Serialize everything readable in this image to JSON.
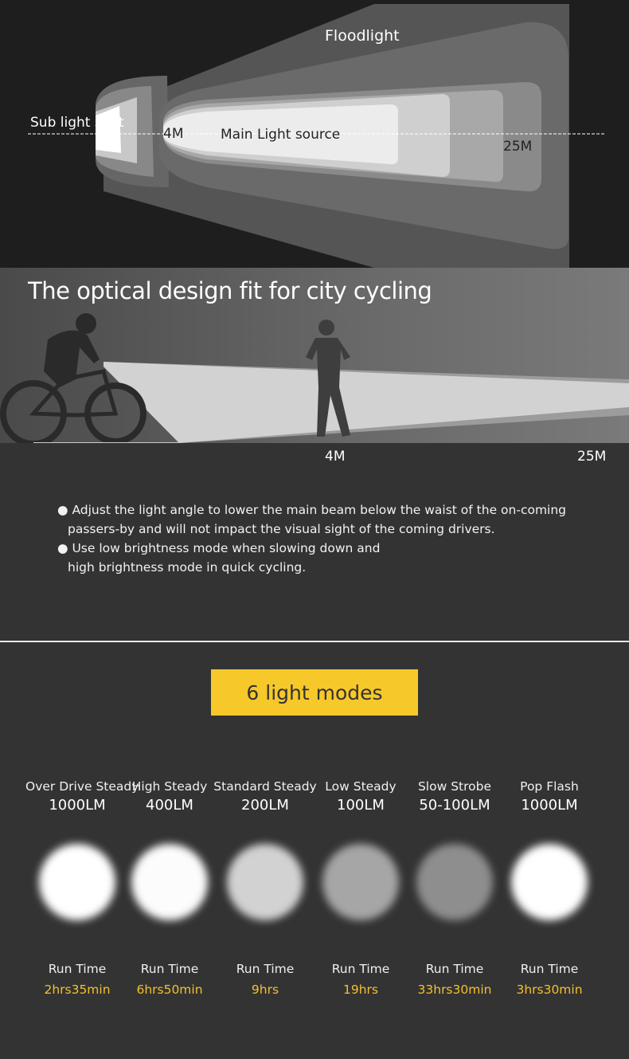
{
  "beam_diagram": {
    "floodlight": "Floodlight",
    "sub_light_spot": "Sub light spot",
    "main_light_source": "Main Light source",
    "near_distance": "4M",
    "far_distance": "25M"
  },
  "city": {
    "title": "The optical design fit for city cycling",
    "near_distance": "4M",
    "far_distance": "25M",
    "bullets": [
      "● Adjust the light angle to lower the main beam below the waist of the on-coming passers-by and will not impact the visual sight of the coming drivers.",
      "● Use low brightness mode when slowing down and high brightness mode in quick cycling."
    ]
  },
  "modes_badge": "6 light modes",
  "colors": {
    "accent": "#f7c829",
    "runtime": "#f2c02e"
  },
  "modes": [
    {
      "name": "Over Drive Steady",
      "lumens": "1000LM",
      "run_label": "Run Time",
      "run_time": "2hrs35min",
      "brightness": "#ffffff"
    },
    {
      "name": "High Steady",
      "lumens": "400LM",
      "run_label": "Run Time",
      "run_time": "6hrs50min",
      "brightness": "#fcfcfc"
    },
    {
      "name": "Standard Steady",
      "lumens": "200LM",
      "run_label": "Run Time",
      "run_time": "9hrs",
      "brightness": "#d2d2d2"
    },
    {
      "name": "Low Steady",
      "lumens": "100LM",
      "run_label": "Run Time",
      "run_time": "19hrs",
      "brightness": "#a6a6a6"
    },
    {
      "name": "Slow Strobe",
      "lumens": "50-100LM",
      "run_label": "Run Time",
      "run_time": "33hrs30min",
      "brightness": "#8e8e8e"
    },
    {
      "name": "Pop Flash",
      "lumens": "1000LM",
      "run_label": "Run Time",
      "run_time": "3hrs30min",
      "brightness": "#ffffff"
    }
  ]
}
